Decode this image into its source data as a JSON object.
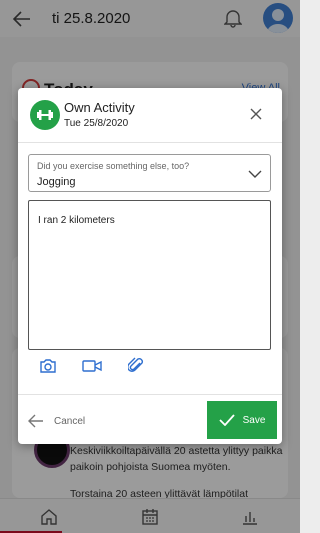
{
  "header": {
    "date": "ti 25.8.2020"
  },
  "today_card": {
    "title": "Today",
    "view_all": "View All"
  },
  "news": {
    "line1": "Keskiviikkoiltapäivällä 20 astetta ylittyy paikka paikoin pohjoista Suomea myöten.",
    "line2": "Torstaina 20 asteen ylittävät lämpötilat"
  },
  "dialog": {
    "title": "Own Activity",
    "date": "Tue 25/8/2020",
    "select_label": "Did you exercise something else, too?",
    "select_value": "Jogging",
    "note": "I ran 2 kilometers",
    "cancel_label": "Cancel",
    "save_label": "Save"
  },
  "colors": {
    "accent_green": "#24a148",
    "brand_red": "#c8102e",
    "link_blue": "#2f6fcf"
  },
  "icons": [
    "back-arrow-icon",
    "bell-icon",
    "avatar-icon",
    "dumbbell-icon",
    "close-icon",
    "chevron-down-icon",
    "camera-icon",
    "video-icon",
    "paperclip-icon",
    "checkmark-icon",
    "home-icon",
    "calendar-icon",
    "stats-icon"
  ]
}
